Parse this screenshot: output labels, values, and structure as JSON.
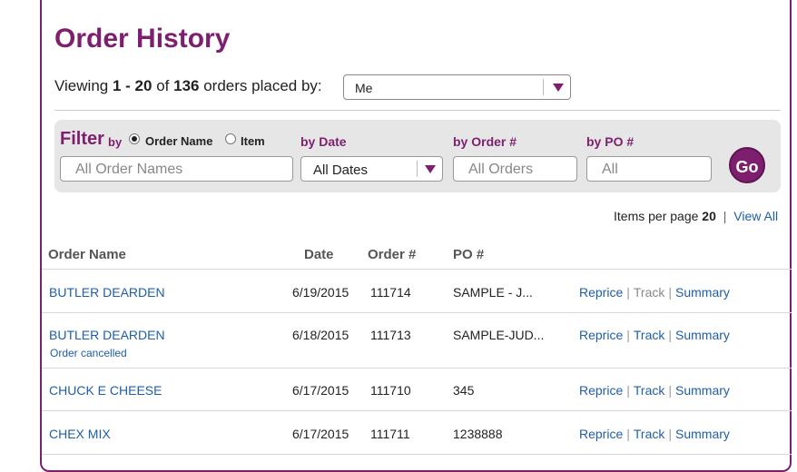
{
  "page": {
    "title": "Order History"
  },
  "viewing": {
    "prefix": "Viewing",
    "range": "1 - 20",
    "of": "of",
    "total": "136",
    "suffix": "orders placed by:"
  },
  "placed_by_select": {
    "value": "Me"
  },
  "filter": {
    "label": "Filter",
    "by": "by",
    "radio_order_name": "Order Name",
    "radio_item": "Item",
    "selected": "Order Name",
    "by_date_label": "by Date",
    "by_order_label": "by Order #",
    "by_po_label": "by PO #",
    "order_names_placeholder": "All Order Names",
    "dates_value": "All Dates",
    "orders_placeholder": "All Orders",
    "po_placeholder": "All",
    "go_label": "Go"
  },
  "items_per_page": {
    "label": "Items per page",
    "value": "20",
    "separator": "|",
    "view_all": "View All"
  },
  "table": {
    "headers": {
      "order_name": "Order Name",
      "date": "Date",
      "order_num": "Order #",
      "po_num": "PO #"
    },
    "action_labels": {
      "reprice": "Reprice",
      "track": "Track",
      "summary": "Summary",
      "separator": "|"
    },
    "rows": [
      {
        "name": "BUTLER DEARDEN",
        "date": "6/19/2015",
        "order": "111714",
        "po": "SAMPLE - J...",
        "note": "",
        "track_enabled": false
      },
      {
        "name": "BUTLER DEARDEN",
        "date": "6/18/2015",
        "order": "111713",
        "po": "SAMPLE-JUD...",
        "note": "Order cancelled",
        "track_enabled": true
      },
      {
        "name": "CHUCK E CHEESE",
        "date": "6/17/2015",
        "order": "111710",
        "po": "345",
        "note": "",
        "track_enabled": true
      },
      {
        "name": "CHEX MIX",
        "date": "6/17/2015",
        "order": "111711",
        "po": "1238888",
        "note": "",
        "track_enabled": true
      }
    ]
  },
  "colors": {
    "brand": "#7d1f6e",
    "link": "#1f5ea8"
  }
}
